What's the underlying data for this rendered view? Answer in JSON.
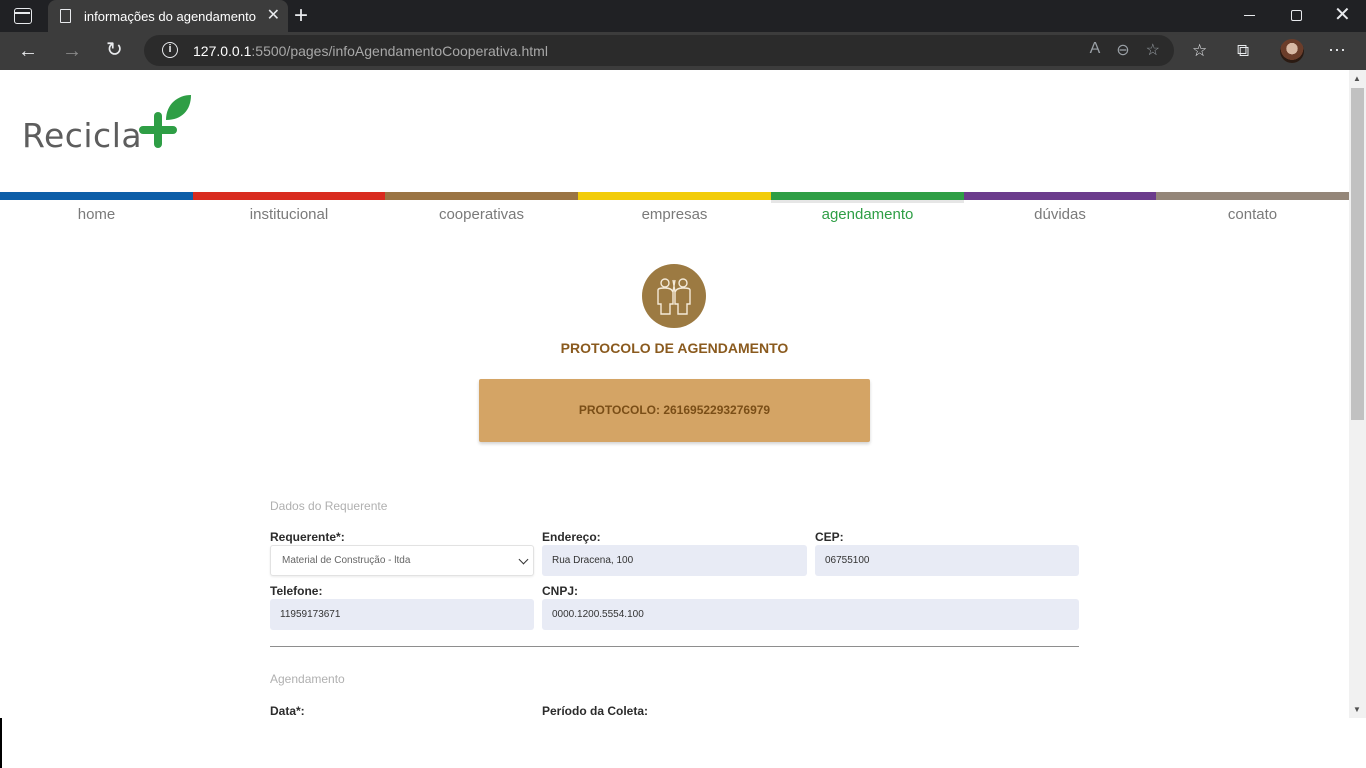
{
  "browser": {
    "tab_title": "informações do agendamento",
    "tab_close": "✕",
    "new_tab": "+",
    "url_host": "127.0.0.1",
    "url_path": ":5500/pages/infoAgendamentoCooperativa.html",
    "info_glyph": "i",
    "win_close": "✕"
  },
  "logo": {
    "text": "Recicla"
  },
  "nav": {
    "items": [
      {
        "label": "home",
        "color": "#0d5ea8"
      },
      {
        "label": "institucional",
        "color": "#d92b1f"
      },
      {
        "label": "cooperativas",
        "color": "#9a7444"
      },
      {
        "label": "empresas",
        "color": "#f2cc09"
      },
      {
        "label": "agendamento",
        "color": "#2e9e45",
        "active": true
      },
      {
        "label": "dúvidas",
        "color": "#6b3c8c"
      },
      {
        "label": "contato",
        "color": "#948679"
      }
    ]
  },
  "header": {
    "title": "PROTOCOLO DE AGENDAMENTO",
    "icon": "people-icon"
  },
  "protocol": {
    "text": "PROTOCOLO: 2616952293276979"
  },
  "requester": {
    "section": "Dados do Requerente",
    "requerente_label": "Requerente*:",
    "requerente_value": "Material de Construção - ltda",
    "endereco_label": "Endereço:",
    "endereco_value": "Rua Dracena, 100",
    "cep_label": "CEP:",
    "cep_value": "06755100",
    "telefone_label": "Telefone:",
    "telefone_value": "11959173671",
    "cnpj_label": "CNPJ:",
    "cnpj_value": "0000.1200.5554.100"
  },
  "schedule": {
    "section": "Agendamento",
    "data_label": "Data*:",
    "periodo_label": "Período da Coleta:"
  },
  "colors": {
    "accent_green": "#2e9e45",
    "protocol_bg": "#d4a465",
    "title_brown": "#8a5a1e"
  }
}
